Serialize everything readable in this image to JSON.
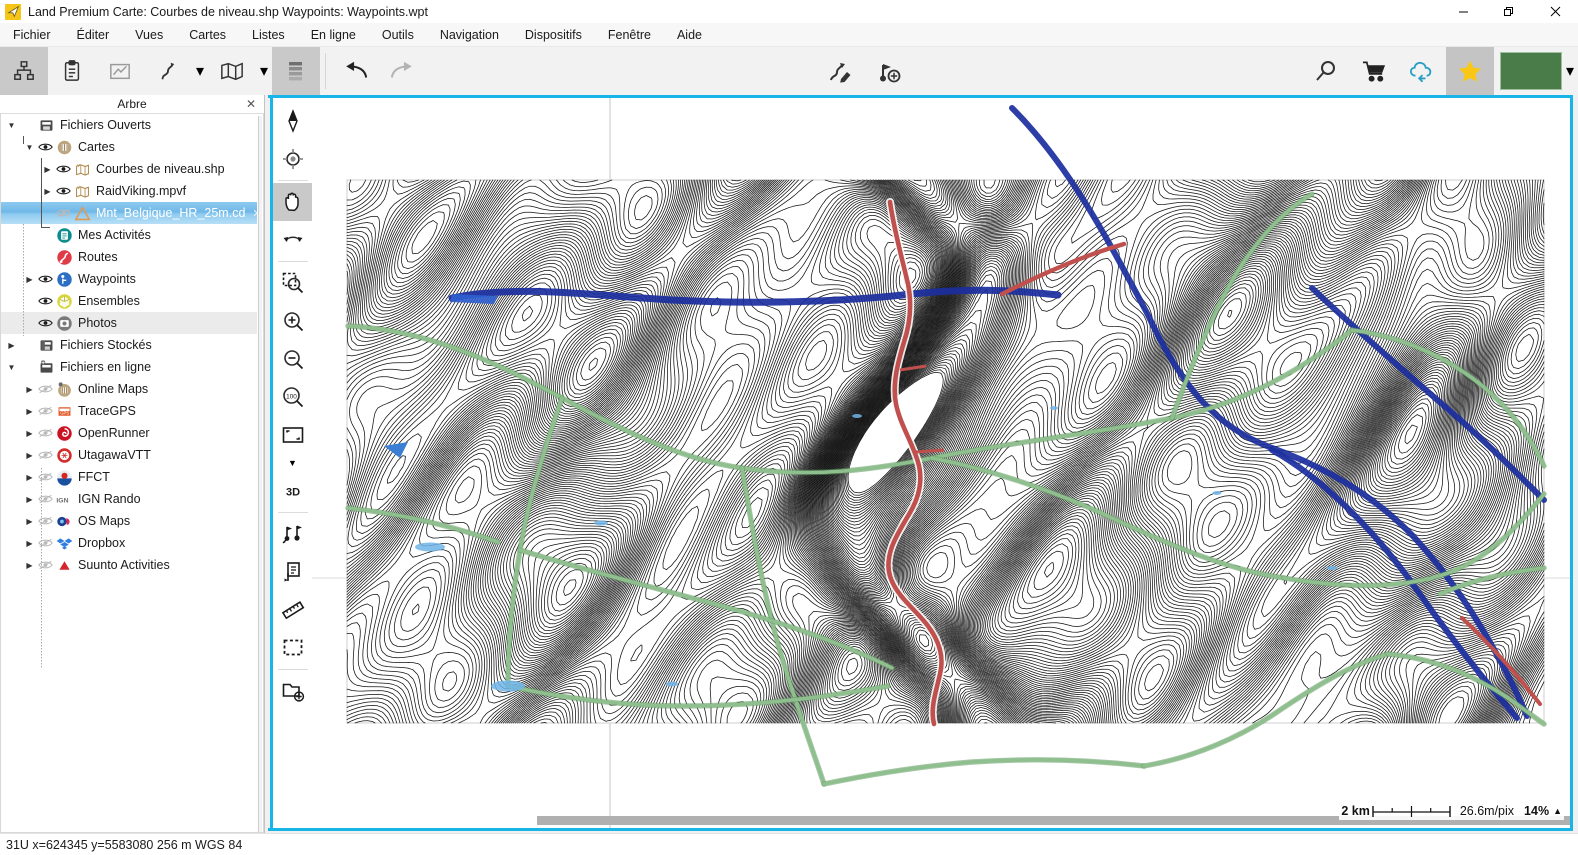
{
  "window": {
    "title": "Land Premium Carte: Courbes de niveau.shp Waypoints:  Waypoints.wpt",
    "logo_icon": "paper-plane-icon",
    "minimize_label": "—",
    "maximize_label": "❐",
    "close_label": "✕"
  },
  "menubar": {
    "items": [
      {
        "label": "Fichier"
      },
      {
        "label": "Éditer"
      },
      {
        "label": "Vues"
      },
      {
        "label": "Cartes"
      },
      {
        "label": "Listes"
      },
      {
        "label": "En ligne"
      },
      {
        "label": "Outils"
      },
      {
        "label": "Navigation"
      },
      {
        "label": "Dispositifs"
      },
      {
        "label": "Fenêtre"
      },
      {
        "label": "Aide"
      }
    ]
  },
  "toolbar": {
    "tree_view_icon": "tree-hierarchy-icon",
    "clipboard_icon": "clipboard-icon",
    "graph_icon": "elevation-graph-icon",
    "track_icon": "track-route-icon",
    "track_caret": "▾",
    "map_icon": "folded-map-icon",
    "map_caret": "▾",
    "layers_icon": "layers-stack-icon",
    "undo_icon": "undo-arrow-icon",
    "redo_icon": "redo-arrow-icon",
    "edit_track_icon": "edit-track-pencil-icon",
    "add_waypoint_icon": "add-waypoint-flag-icon",
    "search_icon": "magnifier-icon",
    "cart_icon": "shopping-cart-icon",
    "cloud_icon": "cloud-download-icon",
    "star_icon": "star-favorite-icon",
    "color_swatch": "#4a7c4a",
    "color_caret": "▾"
  },
  "tree": {
    "title": "Arbre",
    "close_label": "✕",
    "nodes": [
      {
        "label": "Fichiers Ouverts",
        "icon": "open-files-icon",
        "indent": 0,
        "twist": "▼",
        "eye": false
      },
      {
        "label": "Cartes",
        "icon": "maps-stack-icon",
        "indent": 1,
        "twist": "▼",
        "eye": true
      },
      {
        "label": "Courbes de niveau.shp",
        "icon": "vector-map-icon",
        "indent": 2,
        "twist": "▶",
        "eye": true
      },
      {
        "label": "RaidViking.mpvf",
        "icon": "vector-map-icon",
        "indent": 2,
        "twist": "▶",
        "eye": true
      },
      {
        "label": "Mnt_Belgique_HR_25m.cd",
        "icon": "dem-triangle-icon",
        "indent": 2,
        "twist": "",
        "eye": true,
        "selected": true,
        "close": "✕"
      },
      {
        "label": "Mes Activités",
        "icon": "activities-icon",
        "indent": 1,
        "twist": "",
        "eye": false
      },
      {
        "label": "Routes",
        "icon": "routes-icon",
        "indent": 1,
        "twist": "",
        "eye": false
      },
      {
        "label": "Waypoints",
        "icon": "waypoints-icon",
        "indent": 1,
        "twist": "▶",
        "eye": true
      },
      {
        "label": "Ensembles",
        "icon": "ensembles-icon",
        "indent": 1,
        "twist": "",
        "eye": true
      },
      {
        "label": "Photos",
        "icon": "photos-icon",
        "indent": 1,
        "twist": "",
        "eye": true,
        "shaded": true
      },
      {
        "label": "Fichiers Stockés",
        "icon": "stored-files-icon",
        "indent": 0,
        "twist": "▶",
        "eye": false
      },
      {
        "label": "Fichiers en ligne",
        "icon": "online-files-icon",
        "indent": 0,
        "twist": "▼",
        "eye": false
      },
      {
        "label": "Online Maps",
        "icon": "online-maps-icon",
        "indent": 1,
        "twist": "▶",
        "eye": true,
        "eye_off": true
      },
      {
        "label": "TraceGPS",
        "icon": "tracegps-logo-icon",
        "indent": 1,
        "twist": "▶",
        "eye": true,
        "eye_off": true
      },
      {
        "label": "OpenRunner",
        "icon": "openrunner-logo-icon",
        "indent": 1,
        "twist": "▶",
        "eye": true,
        "eye_off": true
      },
      {
        "label": "UtagawaVTT",
        "icon": "utagawavtt-logo-icon",
        "indent": 1,
        "twist": "▶",
        "eye": true,
        "eye_off": true
      },
      {
        "label": "FFCT",
        "icon": "ffct-logo-icon",
        "indent": 1,
        "twist": "▶",
        "eye": true,
        "eye_off": true
      },
      {
        "label": "IGN Rando",
        "icon": "ign-logo-icon",
        "indent": 1,
        "twist": "▶",
        "eye": true,
        "eye_off": true
      },
      {
        "label": "OS Maps",
        "icon": "osmaps-logo-icon",
        "indent": 1,
        "twist": "▶",
        "eye": true,
        "eye_off": true
      },
      {
        "label": "Dropbox",
        "icon": "dropbox-logo-icon",
        "indent": 1,
        "twist": "▶",
        "eye": true,
        "eye_off": true
      },
      {
        "label": "Suunto Activities",
        "icon": "suunto-logo-icon",
        "indent": 1,
        "twist": "▶",
        "eye": true,
        "eye_off": true
      }
    ]
  },
  "maptools": {
    "items": [
      {
        "icon": "compass-needle-icon",
        "active": false
      },
      {
        "icon": "center-target-icon",
        "active": false
      },
      {
        "sep": true
      },
      {
        "icon": "pan-hand-icon",
        "active": true
      },
      {
        "icon": "rotate-back-icon",
        "active": false
      },
      {
        "sep": true
      },
      {
        "icon": "zoom-rectangle-icon",
        "active": false
      },
      {
        "icon": "zoom-in-icon",
        "active": false
      },
      {
        "icon": "zoom-out-icon",
        "active": false
      },
      {
        "icon": "zoom-100-icon",
        "active": false
      },
      {
        "icon": "fit-screen-icon",
        "active": false
      },
      {
        "caret": "▼"
      },
      {
        "icon": "3d-view-icon",
        "active": false
      },
      {
        "sep": true
      },
      {
        "icon": "waypoint-pair-icon",
        "active": false
      },
      {
        "icon": "note-flag-icon",
        "active": false
      },
      {
        "icon": "ruler-measure-icon",
        "active": false
      },
      {
        "icon": "select-rectangle-icon",
        "active": false
      },
      {
        "sep": true
      },
      {
        "icon": "new-map-window-icon",
        "active": false
      }
    ]
  },
  "map": {
    "scale_label": "2 km",
    "meters_per_pixel": "26.6m/pix",
    "zoom_percent": "14%",
    "zoom_caret": "▲",
    "colors": {
      "contour": "#111111",
      "path_green": "#8fbf8f",
      "river_blue": "#1b2f9e",
      "track_red": "#c0504d",
      "water_light": "#6fb5e8",
      "grid_gray": "#999999"
    }
  },
  "statusbar": {
    "text": "31U  x=624345  y=5583080  256 m  WGS 84"
  }
}
